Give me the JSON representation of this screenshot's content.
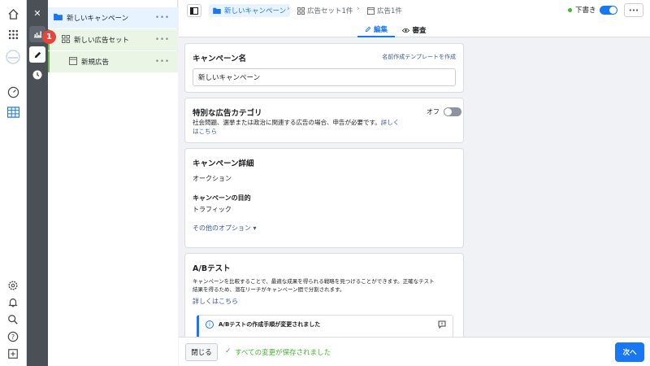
{
  "tools": {
    "badge": "1"
  },
  "tree": {
    "campaign": "新しいキャンペーン",
    "adset": "新しい広告セット",
    "ad": "新規広告",
    "more": "•••"
  },
  "topbar": {
    "breadcrumb": [
      "新しいキャンペーン",
      "広告セット1件",
      "広告1件"
    ],
    "draft_label": "下書き",
    "more": "•••",
    "tabs": {
      "edit": "編集",
      "review": "審査"
    }
  },
  "campaign_name": {
    "title": "キャンペーン名",
    "template_link": "名前作成テンプレートを作成",
    "value": "新しいキャンペーン"
  },
  "special_category": {
    "title": "特別な広告カテゴリ",
    "toggle_label": "オフ",
    "description": "社会問題、選挙または政治に関連する広告の場合、申告が必要です。",
    "learn_more_1": "詳しく",
    "learn_more_2": "はこちら"
  },
  "details": {
    "title": "キャンペーン詳細",
    "buying_type": "オークション",
    "objective_label": "キャンペーンの目的",
    "objective_value": "トラフィック",
    "more_options": "その他のオプション ▾"
  },
  "ab_test": {
    "title": "A/Bテスト",
    "description_1": "キャンペーンを比較することで、最適な成果を得られる戦略を見つけることができます。正確なテスト",
    "description_2": "結果を得るため、潜在リーチがキャンペーン間で分割されます。",
    "learn_more": "詳しくはこちら",
    "notice_title": "A/Bテストの作成手順が変更されました"
  },
  "bottombar": {
    "close": "閉じる",
    "saved": "すべての変更が保存されました",
    "next": "次へ"
  },
  "colors": {
    "accent": "#1877f2",
    "green": "#42b72a",
    "selected_bg": "#e7f3ff",
    "tree_green": "#ebf5e6"
  }
}
